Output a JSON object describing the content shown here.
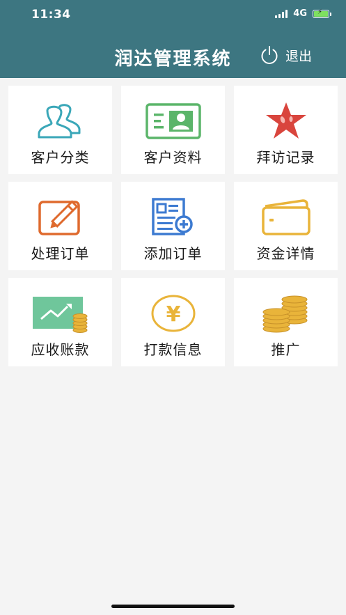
{
  "status_bar": {
    "time": "11:34",
    "network": "4G"
  },
  "header": {
    "title": "润达管理系统",
    "logout_label": "退出"
  },
  "menu": [
    {
      "label": "客户分类",
      "icon": "customers-icon"
    },
    {
      "label": "客户资料",
      "icon": "id-card-icon"
    },
    {
      "label": "拜访记录",
      "icon": "star-icon"
    },
    {
      "label": "处理订单",
      "icon": "edit-icon"
    },
    {
      "label": "添加订单",
      "icon": "add-document-icon"
    },
    {
      "label": "资金详情",
      "icon": "wallet-icon"
    },
    {
      "label": "应收账款",
      "icon": "trend-coins-icon"
    },
    {
      "label": "打款信息",
      "icon": "yen-coin-icon"
    },
    {
      "label": "推广",
      "icon": "coin-stacks-icon"
    }
  ],
  "colors": {
    "header": "#3d7681",
    "background": "#f4f4f4",
    "teal_icon": "#3aa7b8",
    "green_icon": "#5bb56a",
    "red_icon": "#d9453d",
    "orange_icon": "#df6a2e",
    "blue_icon": "#3c7ad1",
    "gold_icon": "#e9b43a"
  }
}
